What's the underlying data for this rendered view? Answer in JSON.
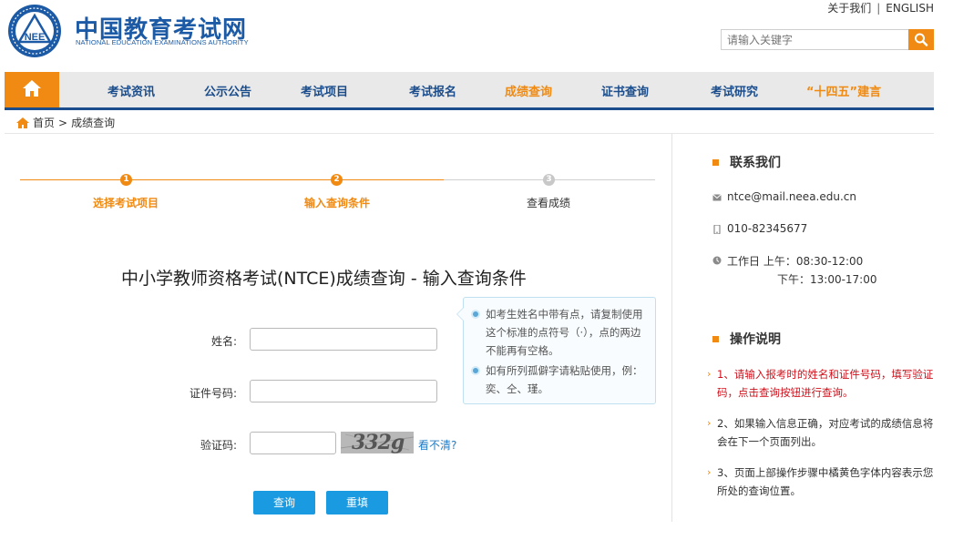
{
  "brand": {
    "logo_text": "NEE",
    "name_cn": "中国教育考试网",
    "name_en": "NATIONAL EDUCATION EXAMINATIONS AUTHORITY"
  },
  "toplinks": {
    "about": "关于我们",
    "separator": "|",
    "english": "ENGLISH"
  },
  "search": {
    "placeholder": "请输入关键字"
  },
  "nav": [
    {
      "label": "考试资讯"
    },
    {
      "label": "公示公告"
    },
    {
      "label": "考试项目"
    },
    {
      "label": "考试报名"
    },
    {
      "label": "成绩查询"
    },
    {
      "label": "证书查询"
    },
    {
      "label": "考试研究"
    },
    {
      "label": "“十四五”建言"
    }
  ],
  "breadcrumb": {
    "home": "首页",
    "separator": ">",
    "current": "成绩查询"
  },
  "steps": [
    {
      "num": "1",
      "label": "选择考试项目"
    },
    {
      "num": "2",
      "label": "输入查询条件"
    },
    {
      "num": "3",
      "label": "查看成绩"
    }
  ],
  "form": {
    "title": "中小学教师资格考试(NTCE)成绩查询 - 输入查询条件",
    "name_label": "姓名:",
    "id_label": "证件号码:",
    "captcha_label": "验证码:",
    "captcha_image_text": "332g",
    "refresh_text": "看不清?",
    "submit": "查询",
    "reset": "重填"
  },
  "tips": [
    "如考生姓名中带有点，请复制使用这个标准的点符号（·），点的两边不能再有空格。",
    "如有所列孤僻字请粘贴使用，例：奕、仝、瑾。"
  ],
  "contact": {
    "title": "联系我们",
    "email": "ntce@mail.neea.edu.cn",
    "phone": "010-82345677",
    "hours_am": "工作日 上午：08:30-12:00",
    "hours_pm": "下午：13:00-17:00"
  },
  "instructions": {
    "title": "操作说明",
    "items": [
      "1、请输入报考时的姓名和证件号码，填写验证码，点击查询按钮进行查询。",
      "2、如果输入信息正确，对应考试的成绩信息将会在下一个页面列出。",
      "3、页面上部操作步骤中橘黄色字体内容表示您所处的查询位置。"
    ]
  },
  "colors": {
    "brand_blue": "#1c5aa5",
    "accent_orange": "#f08a12",
    "button_blue": "#1a9ae0",
    "alert_red": "#d0101b"
  }
}
